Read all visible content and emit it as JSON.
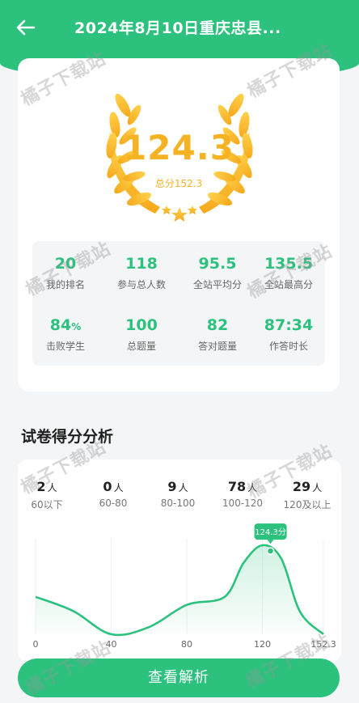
{
  "header": {
    "title": "2024年8月10日重庆忠县...",
    "back_icon": "back-arrow-icon"
  },
  "score": {
    "value": "124.3",
    "total": "总分152.3"
  },
  "stats": [
    {
      "value": "20",
      "label": "我的排名"
    },
    {
      "value": "118",
      "label": "参与总人数"
    },
    {
      "value": "95.5",
      "label": "全站平均分"
    },
    {
      "value": "135.5",
      "label": "全站最高分"
    },
    {
      "value": "84",
      "unit": "%",
      "label": "击败学生"
    },
    {
      "value": "100",
      "label": "总题量"
    },
    {
      "value": "82",
      "label": "答对题量"
    },
    {
      "value": "87:34",
      "label": "作答时长"
    }
  ],
  "analysis": {
    "title": "试卷得分分析",
    "buckets": [
      {
        "count": "2",
        "unit": "人",
        "range": "60以下"
      },
      {
        "count": "0",
        "unit": "人",
        "range": "60-80"
      },
      {
        "count": "9",
        "unit": "人",
        "range": "80-100"
      },
      {
        "count": "78",
        "unit": "人",
        "range": "100-120"
      },
      {
        "count": "29",
        "unit": "人",
        "range": "120及以上"
      }
    ],
    "marker_label": "124.3分"
  },
  "chart_data": {
    "type": "area",
    "x_ticks": [
      "0",
      "40",
      "80",
      "120",
      "152.3"
    ],
    "xlim": [
      0,
      152.3
    ],
    "x": [
      0,
      20,
      40,
      60,
      80,
      100,
      110,
      120,
      130,
      140,
      152.3
    ],
    "y": [
      0.42,
      0.26,
      0.0,
      0.08,
      0.33,
      0.42,
      0.8,
      1.0,
      0.85,
      0.25,
      0.0
    ],
    "marker": {
      "x": 124.3,
      "label": "124.3分"
    },
    "color": "#2cc27e"
  },
  "button": {
    "label": "查看解析"
  },
  "watermark": "橘子下载站",
  "colors": {
    "accent": "#2cc27e",
    "gold": "#f5b323"
  }
}
